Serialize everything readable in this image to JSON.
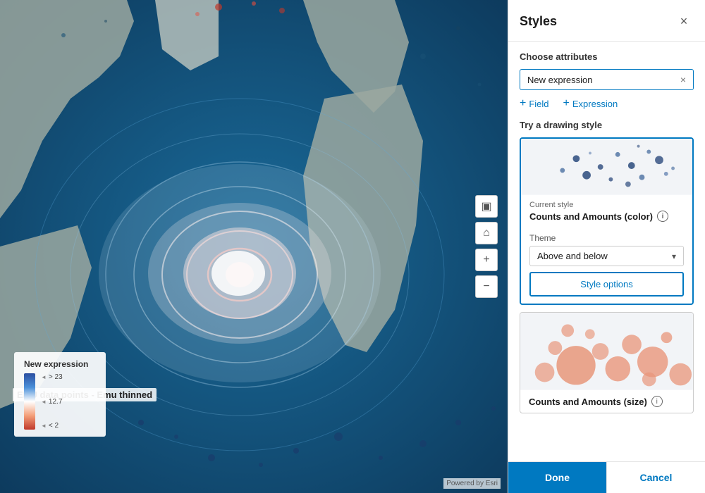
{
  "panel": {
    "title": "Styles",
    "close_icon": "×",
    "choose_attributes_heading": "Choose attributes",
    "expression_tag_text": "New expression",
    "expression_tag_close": "×",
    "add_field_label": "+ Field",
    "add_expression_label": "+ Expression",
    "drawing_style_heading": "Try a drawing style",
    "current_style_label": "Current style",
    "style1_name": "Counts and Amounts (color)",
    "theme_label": "Theme",
    "theme_value": "Above and below",
    "style_options_btn": "Style options",
    "style2_name": "Counts and Amounts (size)",
    "done_btn": "Done",
    "cancel_btn": "Cancel"
  },
  "legend": {
    "title": "New expression",
    "label_top": "> 23",
    "label_mid": "12.7",
    "label_bot": "< 2"
  },
  "map": {
    "layer_label": "EMU data points - Emu thinned",
    "esri_credit": "Powered by Esri"
  },
  "icons": {
    "close": "×",
    "chevron_down": "▾",
    "plus": "+",
    "info": "i",
    "zoom_in": "+",
    "zoom_out": "−",
    "home": "⌂",
    "layers": "▣"
  }
}
